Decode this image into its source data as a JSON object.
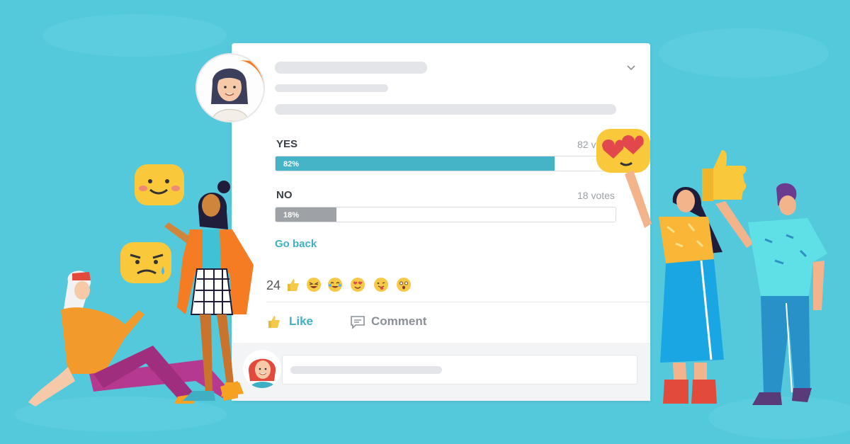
{
  "poll": {
    "options": [
      {
        "label": "YES",
        "percent": 82,
        "percent_label": "82%",
        "votes_label": "82 votes",
        "color": "#45b4c6"
      },
      {
        "label": "NO",
        "percent": 18,
        "percent_label": "18%",
        "votes_label": "18 votes",
        "color": "#9ea2a6"
      }
    ],
    "go_back": "Go back"
  },
  "reactions": {
    "count": "24",
    "icons": [
      "thumbs-up-icon",
      "laughing-face-icon",
      "crying-laugh-face-icon",
      "heart-eyes-face-icon",
      "tongue-face-icon",
      "surprised-face-icon"
    ]
  },
  "actions": {
    "like": "Like",
    "comment": "Comment"
  },
  "colors": {
    "background": "#55c9dc",
    "accent": "#3fb0c4",
    "like": "#3fb0c4",
    "comment": "#8a9096"
  }
}
